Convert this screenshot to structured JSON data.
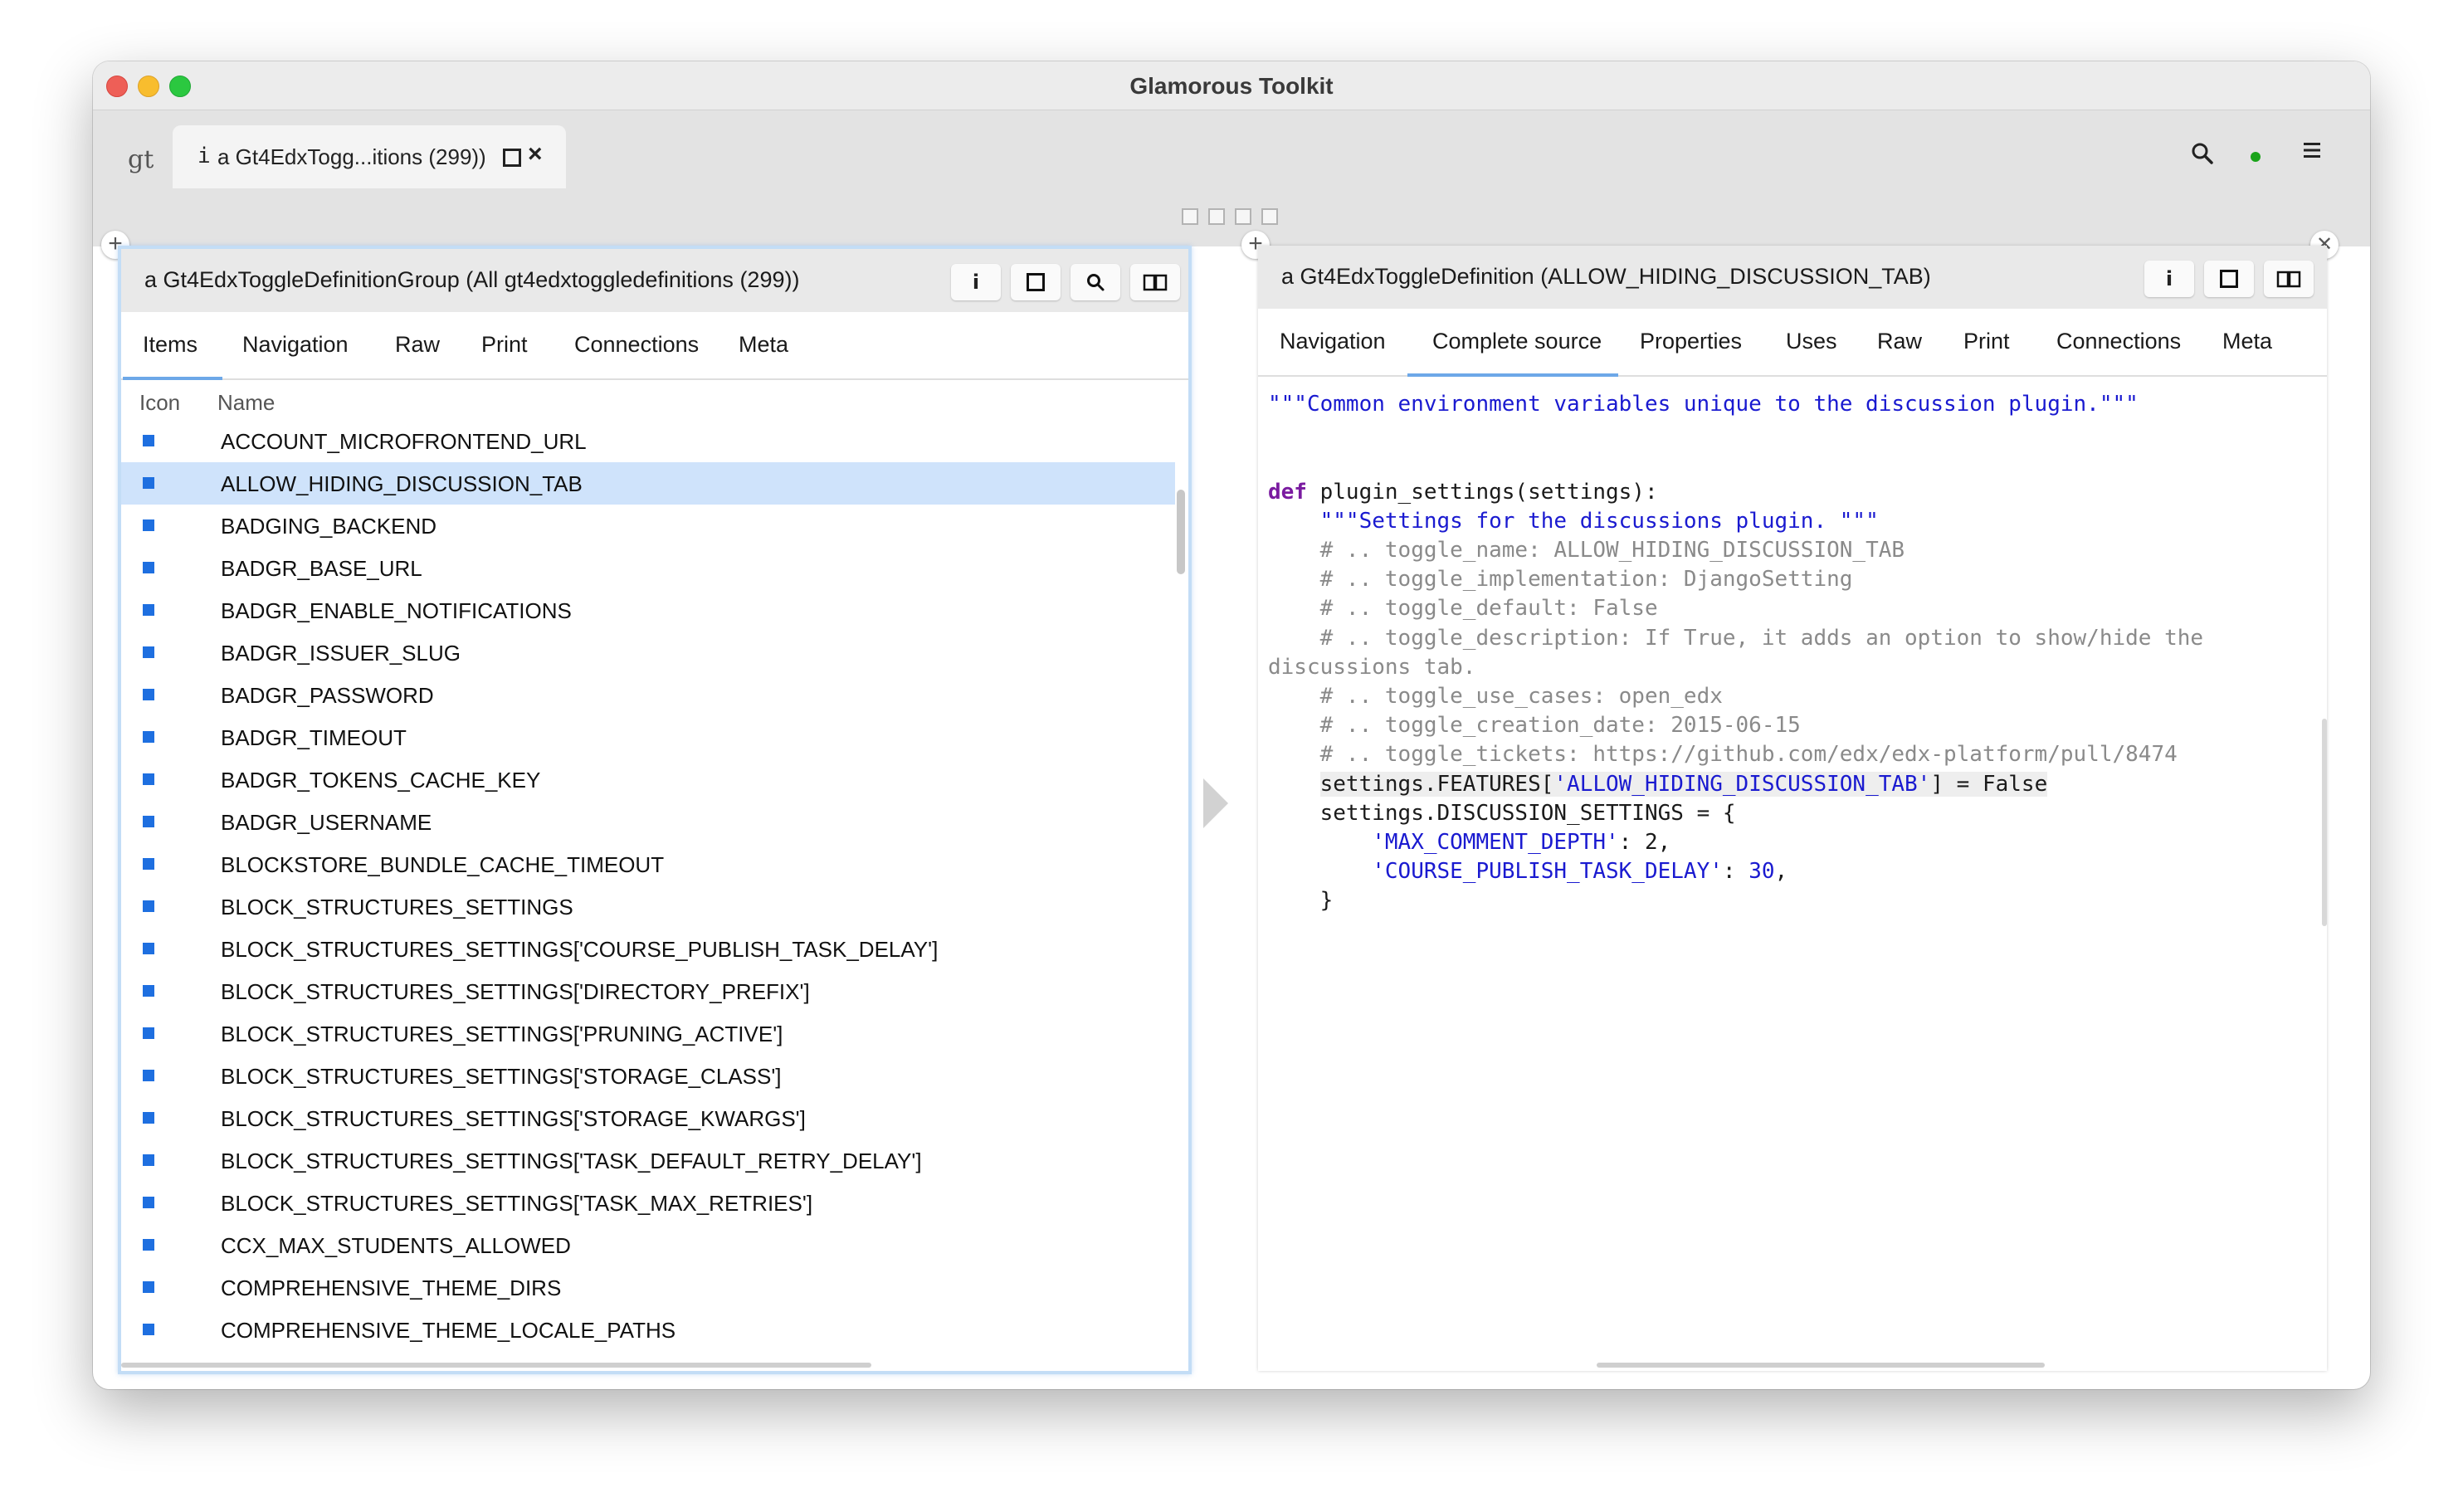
{
  "window": {
    "title": "Glamorous Toolkit"
  },
  "tabbar": {
    "logo": "gt",
    "tab": {
      "icon": "i",
      "label": "a Gt4EdxTogg...itions (299))"
    }
  },
  "left_pane": {
    "title": "a Gt4EdxToggleDefinitionGroup (All gt4edxtoggledefinitions (299))",
    "buttons": [
      "i",
      "",
      "",
      ""
    ],
    "tabs": [
      "Items",
      "Navigation",
      "Raw",
      "Print",
      "Connections",
      "Meta"
    ],
    "active_tab": "Items",
    "columns": {
      "icon": "Icon",
      "name": "Name"
    },
    "rows": [
      "ACCOUNT_MICROFRONTEND_URL",
      "ALLOW_HIDING_DISCUSSION_TAB",
      "BADGING_BACKEND",
      "BADGR_BASE_URL",
      "BADGR_ENABLE_NOTIFICATIONS",
      "BADGR_ISSUER_SLUG",
      "BADGR_PASSWORD",
      "BADGR_TIMEOUT",
      "BADGR_TOKENS_CACHE_KEY",
      "BADGR_USERNAME",
      "BLOCKSTORE_BUNDLE_CACHE_TIMEOUT",
      "BLOCK_STRUCTURES_SETTINGS",
      "BLOCK_STRUCTURES_SETTINGS['COURSE_PUBLISH_TASK_DELAY']",
      "BLOCK_STRUCTURES_SETTINGS['DIRECTORY_PREFIX']",
      "BLOCK_STRUCTURES_SETTINGS['PRUNING_ACTIVE']",
      "BLOCK_STRUCTURES_SETTINGS['STORAGE_CLASS']",
      "BLOCK_STRUCTURES_SETTINGS['STORAGE_KWARGS']",
      "BLOCK_STRUCTURES_SETTINGS['TASK_DEFAULT_RETRY_DELAY']",
      "BLOCK_STRUCTURES_SETTINGS['TASK_MAX_RETRIES']",
      "CCX_MAX_STUDENTS_ALLOWED",
      "COMPREHENSIVE_THEME_DIRS",
      "COMPREHENSIVE_THEME_LOCALE_PATHS"
    ],
    "selected_index": 1
  },
  "right_pane": {
    "title": "a Gt4EdxToggleDefinition (ALLOW_HIDING_DISCUSSION_TAB)",
    "buttons": [
      "i",
      "",
      ""
    ],
    "tabs": [
      "Navigation",
      "Complete source",
      "Properties",
      "Uses",
      "Raw",
      "Print",
      "Connections",
      "Meta"
    ],
    "active_tab": "Complete source",
    "code": {
      "module_doc": "\"\"\"Common environment variables unique to the discussion plugin.\"\"\"",
      "def_keyword": "def",
      "def_signature": " plugin_settings(settings):",
      "func_doc": "\"\"\"Settings for the discussions plugin. \"\"\"",
      "comments": [
        "# .. toggle_name: ALLOW_HIDING_DISCUSSION_TAB",
        "# .. toggle_implementation: DjangoSetting",
        "# .. toggle_default: False",
        "# .. toggle_description: If True, it adds an option to show/hide the discussions tab.",
        "# .. toggle_use_cases: open_edx",
        "# .. toggle_creation_date: 2015-06-15",
        "# .. toggle_tickets: https://github.com/edx/edx-platform/pull/8474"
      ],
      "features_prefix": "settings.FEATURES[",
      "features_key": "'ALLOW_HIDING_DISCUSSION_TAB'",
      "features_suffix": "] = False",
      "discussion_line": "settings.DISCUSSION_SETTINGS = {",
      "entry1_key": "'MAX_COMMENT_DEPTH'",
      "entry1_sep": ": ",
      "entry1_val": "2",
      "entry1_end": ",",
      "entry2_key": "'COURSE_PUBLISH_TASK_DELAY'",
      "entry2_sep": ": ",
      "entry2_val": "30",
      "entry2_end": ",",
      "close_brace": "}"
    }
  },
  "icons": {
    "tab_square": "square-icon",
    "tab_close": "close-icon",
    "search": "search-icon",
    "status": "status-dot-icon",
    "menu": "menu-icon"
  },
  "colors": {
    "item_icon": "#1e6fe0",
    "selection": "#cfe3fb",
    "tab_underline": "#6da8e8",
    "docstring": "#1a1ad0",
    "keyword": "#7a1ba0",
    "comment": "#8a8a8a"
  }
}
